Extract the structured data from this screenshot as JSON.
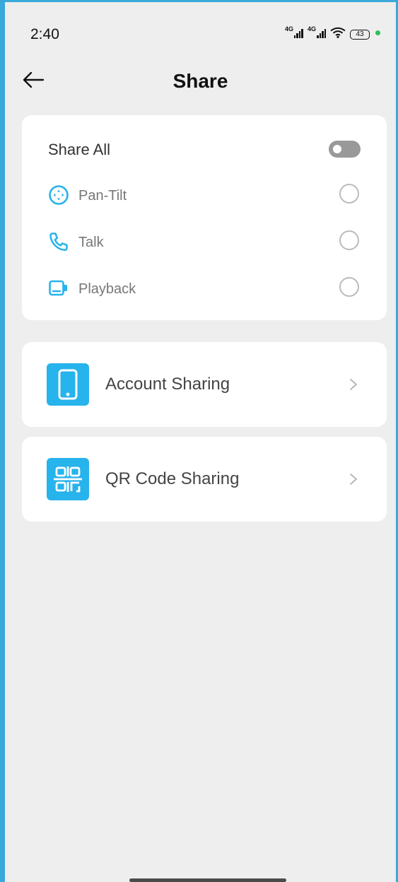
{
  "status_bar": {
    "time": "2:40",
    "network_1": "4G",
    "network_2": "4G",
    "battery": "43",
    "wifi_icon": "wifi-icon",
    "charging_dot_color": "#2fbf5a"
  },
  "header": {
    "title": "Share",
    "back_icon": "arrow-left-icon"
  },
  "permissions": {
    "share_all_label": "Share All",
    "share_all_on": false,
    "items": [
      {
        "label": "Pan-Tilt",
        "icon": "pan-tilt-icon",
        "selected": false
      },
      {
        "label": "Talk",
        "icon": "phone-icon",
        "selected": false
      },
      {
        "label": "Playback",
        "icon": "playback-icon",
        "selected": false
      }
    ]
  },
  "sharing_options": [
    {
      "label": "Account Sharing",
      "icon": "smartphone-icon"
    },
    {
      "label": "QR Code Sharing",
      "icon": "qr-code-icon"
    }
  ],
  "colors": {
    "accent": "#27b3ec",
    "background": "#eeeeee",
    "card": "#ffffff"
  }
}
